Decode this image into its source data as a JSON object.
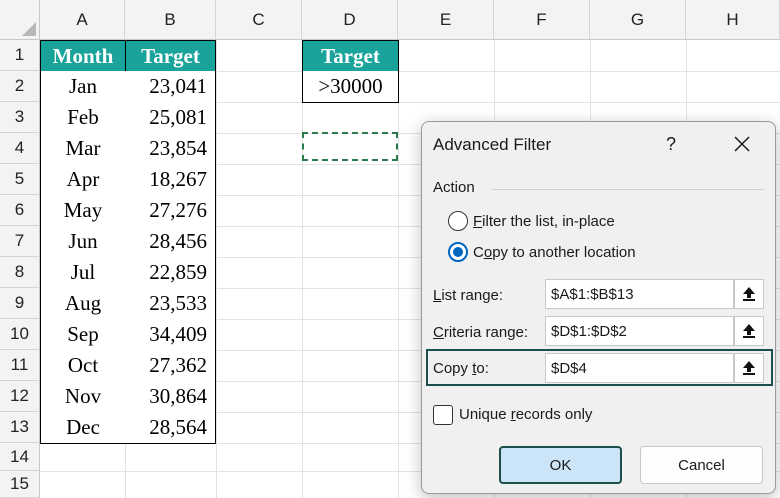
{
  "columns": [
    "A",
    "B",
    "C",
    "D",
    "E",
    "F",
    "G",
    "H"
  ],
  "rows": [
    "1",
    "2",
    "3",
    "4",
    "5",
    "6",
    "7",
    "8",
    "9",
    "10",
    "11",
    "12",
    "13",
    "14",
    "15"
  ],
  "table": {
    "headers": [
      "Month",
      "Target"
    ],
    "data": [
      {
        "month": "Jan",
        "target": "23,041"
      },
      {
        "month": "Feb",
        "target": "25,081"
      },
      {
        "month": "Mar",
        "target": "23,854"
      },
      {
        "month": "Apr",
        "target": "18,267"
      },
      {
        "month": "May",
        "target": "27,276"
      },
      {
        "month": "Jun",
        "target": "28,456"
      },
      {
        "month": "Jul",
        "target": "22,859"
      },
      {
        "month": "Aug",
        "target": "23,533"
      },
      {
        "month": "Sep",
        "target": "34,409"
      },
      {
        "month": "Oct",
        "target": "27,362"
      },
      {
        "month": "Nov",
        "target": "30,864"
      },
      {
        "month": "Dec",
        "target": "28,564"
      }
    ]
  },
  "criteria": {
    "header": "Target",
    "value": ">30000"
  },
  "dialog": {
    "title": "Advanced Filter",
    "help": "?",
    "action_label": "Action",
    "radio_filter_pre": "",
    "radio_filter_key": "F",
    "radio_filter_post": "ilter the list, in-place",
    "radio_copy_pre": "C",
    "radio_copy_key": "o",
    "radio_copy_post": "py to another location",
    "list_range_key": "L",
    "list_range_post": "ist range:",
    "list_range_value": "$A$1:$B$13",
    "criteria_range_key": "C",
    "criteria_range_post": "riteria range:",
    "criteria_range_value": "$D$1:$D$2",
    "copy_to_pre": "Copy ",
    "copy_to_key": "t",
    "copy_to_post": "o:",
    "copy_to_value": "$D$4",
    "unique_pre": "Unique ",
    "unique_key": "r",
    "unique_post": "ecords only",
    "ok_label": "OK",
    "cancel_label": "Cancel"
  },
  "colors": {
    "header_fill": "#1aa39a",
    "accent": "#0067c0",
    "highlight_border": "#1c4f4b"
  }
}
